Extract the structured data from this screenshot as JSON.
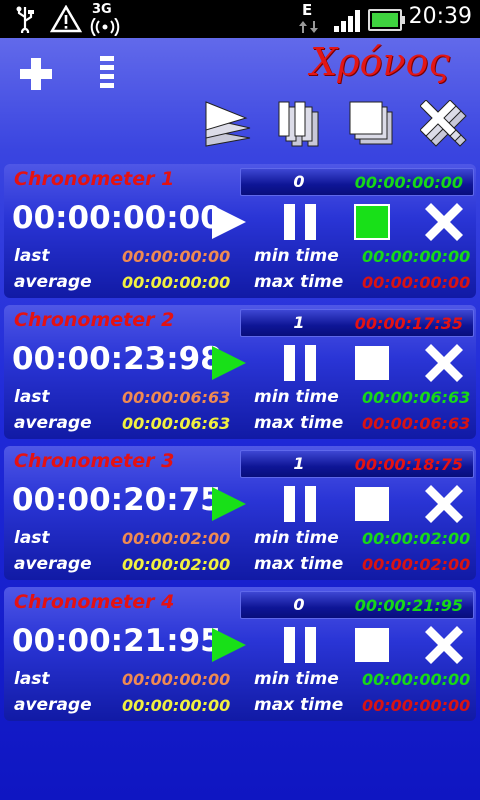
{
  "status_bar": {
    "time": "20:39",
    "network": "3G",
    "data_indicator": "E",
    "icons": [
      "usb-icon",
      "warning-icon",
      "3g-icon",
      "wifi-icon",
      "signal-icon",
      "battery-icon"
    ]
  },
  "header": {
    "app_title": "Χρόνος",
    "tool_icons": [
      "add-icon",
      "menu-icon",
      "start-all-icon",
      "pause-all-icon",
      "stop-all-icon",
      "delete-all-icon"
    ]
  },
  "colors": {
    "accent_red": "#e41212",
    "green": "#18d818",
    "orange": "#ef8a52",
    "yellow": "#f1f140",
    "background": "#1f29d8"
  },
  "labels": {
    "last": "last",
    "average": "average",
    "min_time": "min time",
    "max_time": "max time"
  },
  "chronometers": [
    {
      "name": "Chronometer 1",
      "count": "0",
      "total": "00:00:00:00",
      "display": "00:00:00:00",
      "last": "00:00:00:00",
      "average": "00:00:00:00",
      "min_time": "00:00:00:00",
      "max_time": "00:00:00:00",
      "state": "stopped"
    },
    {
      "name": "Chronometer 2",
      "count": "1",
      "total": "00:00:17:35",
      "display": "00:00:23:98",
      "last": "00:00:06:63",
      "average": "00:00:06:63",
      "min_time": "00:00:06:63",
      "max_time": "00:00:06:63",
      "state": "running"
    },
    {
      "name": "Chronometer 3",
      "count": "1",
      "total": "00:00:18:75",
      "display": "00:00:20:75",
      "last": "00:00:02:00",
      "average": "00:00:02:00",
      "min_time": "00:00:02:00",
      "max_time": "00:00:02:00",
      "state": "running"
    },
    {
      "name": "Chronometer 4",
      "count": "0",
      "total": "00:00:21:95",
      "display": "00:00:21:95",
      "last": "00:00:00:00",
      "average": "00:00:00:00",
      "min_time": "00:00:00:00",
      "max_time": "00:00:00:00",
      "state": "running"
    }
  ]
}
